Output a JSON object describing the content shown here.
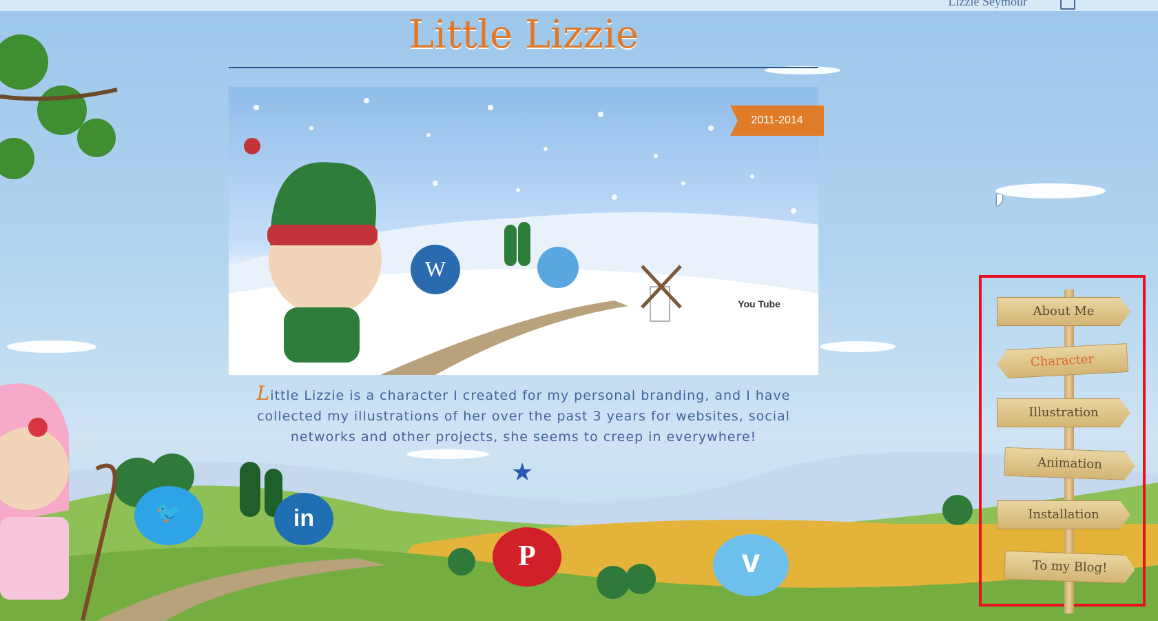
{
  "topbar": {
    "user_name": "Lizzie Seymour"
  },
  "page": {
    "title": "Little Lizzie"
  },
  "hero": {
    "ribbon_label": "2011-2014"
  },
  "intro": {
    "drop_cap": "L",
    "text": "ittle Lizzie is a character I created for my personal branding, and I have collected my illustrations of her over the past 3 years for websites, social networks and other projects, she seems to creep in everywhere!"
  },
  "nav": {
    "items": [
      {
        "label": "About Me"
      },
      {
        "label": "Character"
      },
      {
        "label": "Illustration"
      },
      {
        "label": "Animation"
      },
      {
        "label": "Installation"
      },
      {
        "label": "To my Blog!"
      }
    ]
  },
  "social": {
    "wordpress": "W",
    "youtube": "You Tube",
    "twitter_icon": "twitter-bird-icon",
    "linkedin": "in",
    "pinterest": "P",
    "vimeo": "v"
  },
  "colors": {
    "accent": "#e0782a",
    "heading_rule": "#2c4e86",
    "text": "#41639a",
    "highlight": "#e8101c"
  }
}
